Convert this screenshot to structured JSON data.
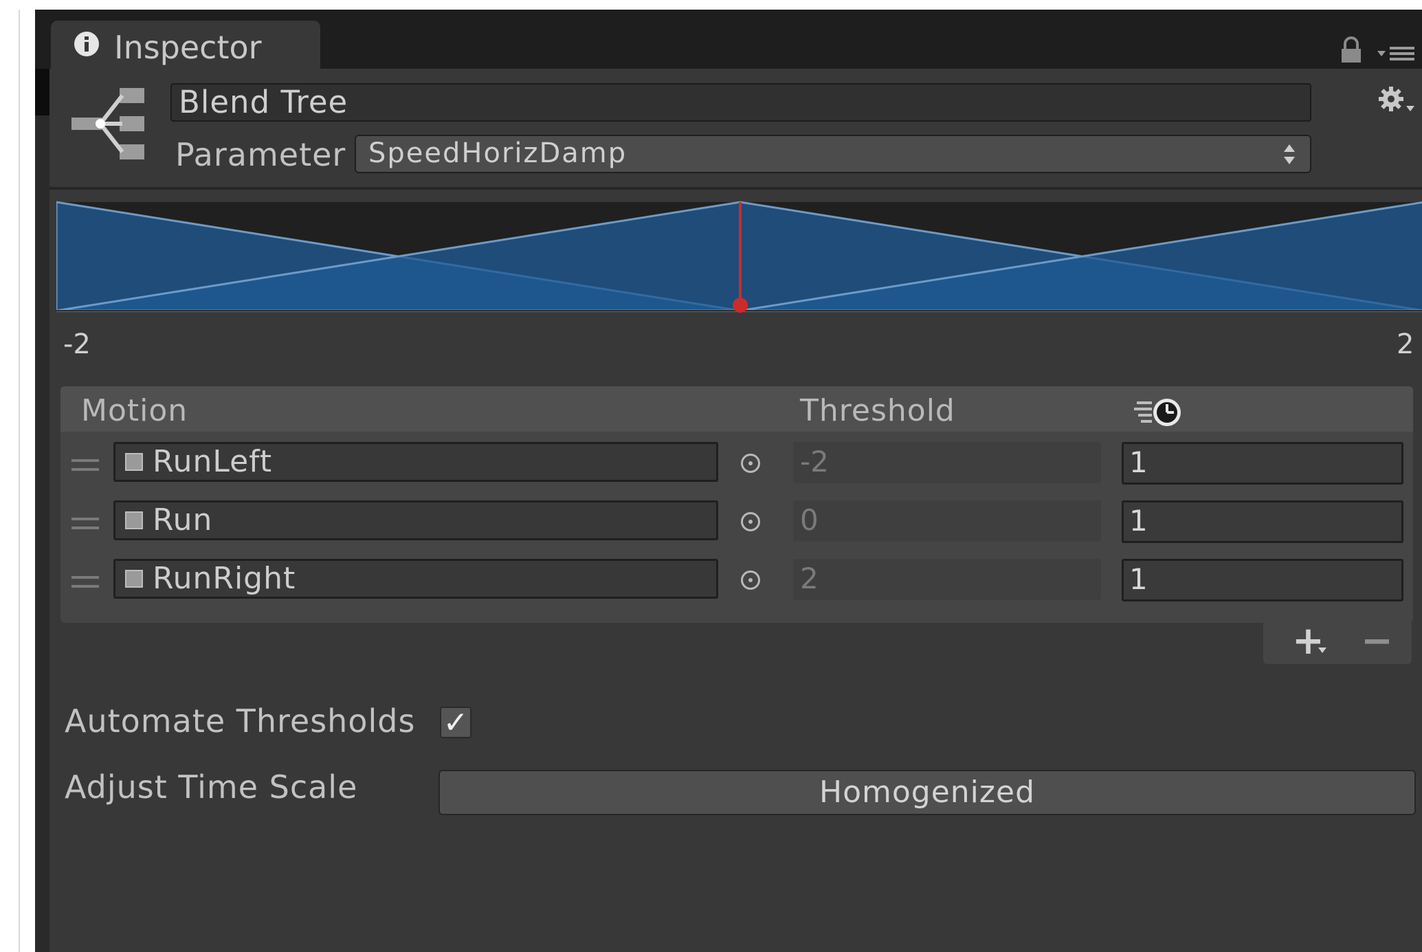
{
  "window": {
    "tab_label": "Inspector",
    "tab_icon": "info-icon",
    "lock_icon": "lock-icon",
    "menu_icon": "context-menu-icon"
  },
  "header": {
    "icon": "blend-tree-icon",
    "name": "Blend Tree",
    "parameter_label": "Parameter",
    "parameter_value": "SpeedHorizDamp",
    "settings_icon": "gear-icon"
  },
  "graph": {
    "min_label": "-2",
    "max_label": "2",
    "min": -2,
    "max": 2,
    "current_value": 0,
    "thresholds": [
      -2,
      0,
      2
    ],
    "colors": {
      "fill": "#1f5b96",
      "line": "#6d9bc7",
      "marker": "#cc2b2b",
      "bg": "#202020"
    }
  },
  "list": {
    "columns": {
      "motion": "Motion",
      "threshold": "Threshold",
      "timescale_icon": "time-scale-icon"
    },
    "rows": [
      {
        "motion": "RunLeft",
        "threshold": "-2",
        "timescale": "1"
      },
      {
        "motion": "Run",
        "threshold": "0",
        "timescale": "1"
      },
      {
        "motion": "RunRight",
        "threshold": "2",
        "timescale": "1"
      }
    ],
    "add_label": "+",
    "remove_label": "−"
  },
  "options": {
    "automate_label": "Automate Thresholds",
    "automate_checked": true,
    "check_glyph": "✓",
    "timescale_label": "Adjust Time Scale",
    "timescale_button": "Homogenized"
  }
}
